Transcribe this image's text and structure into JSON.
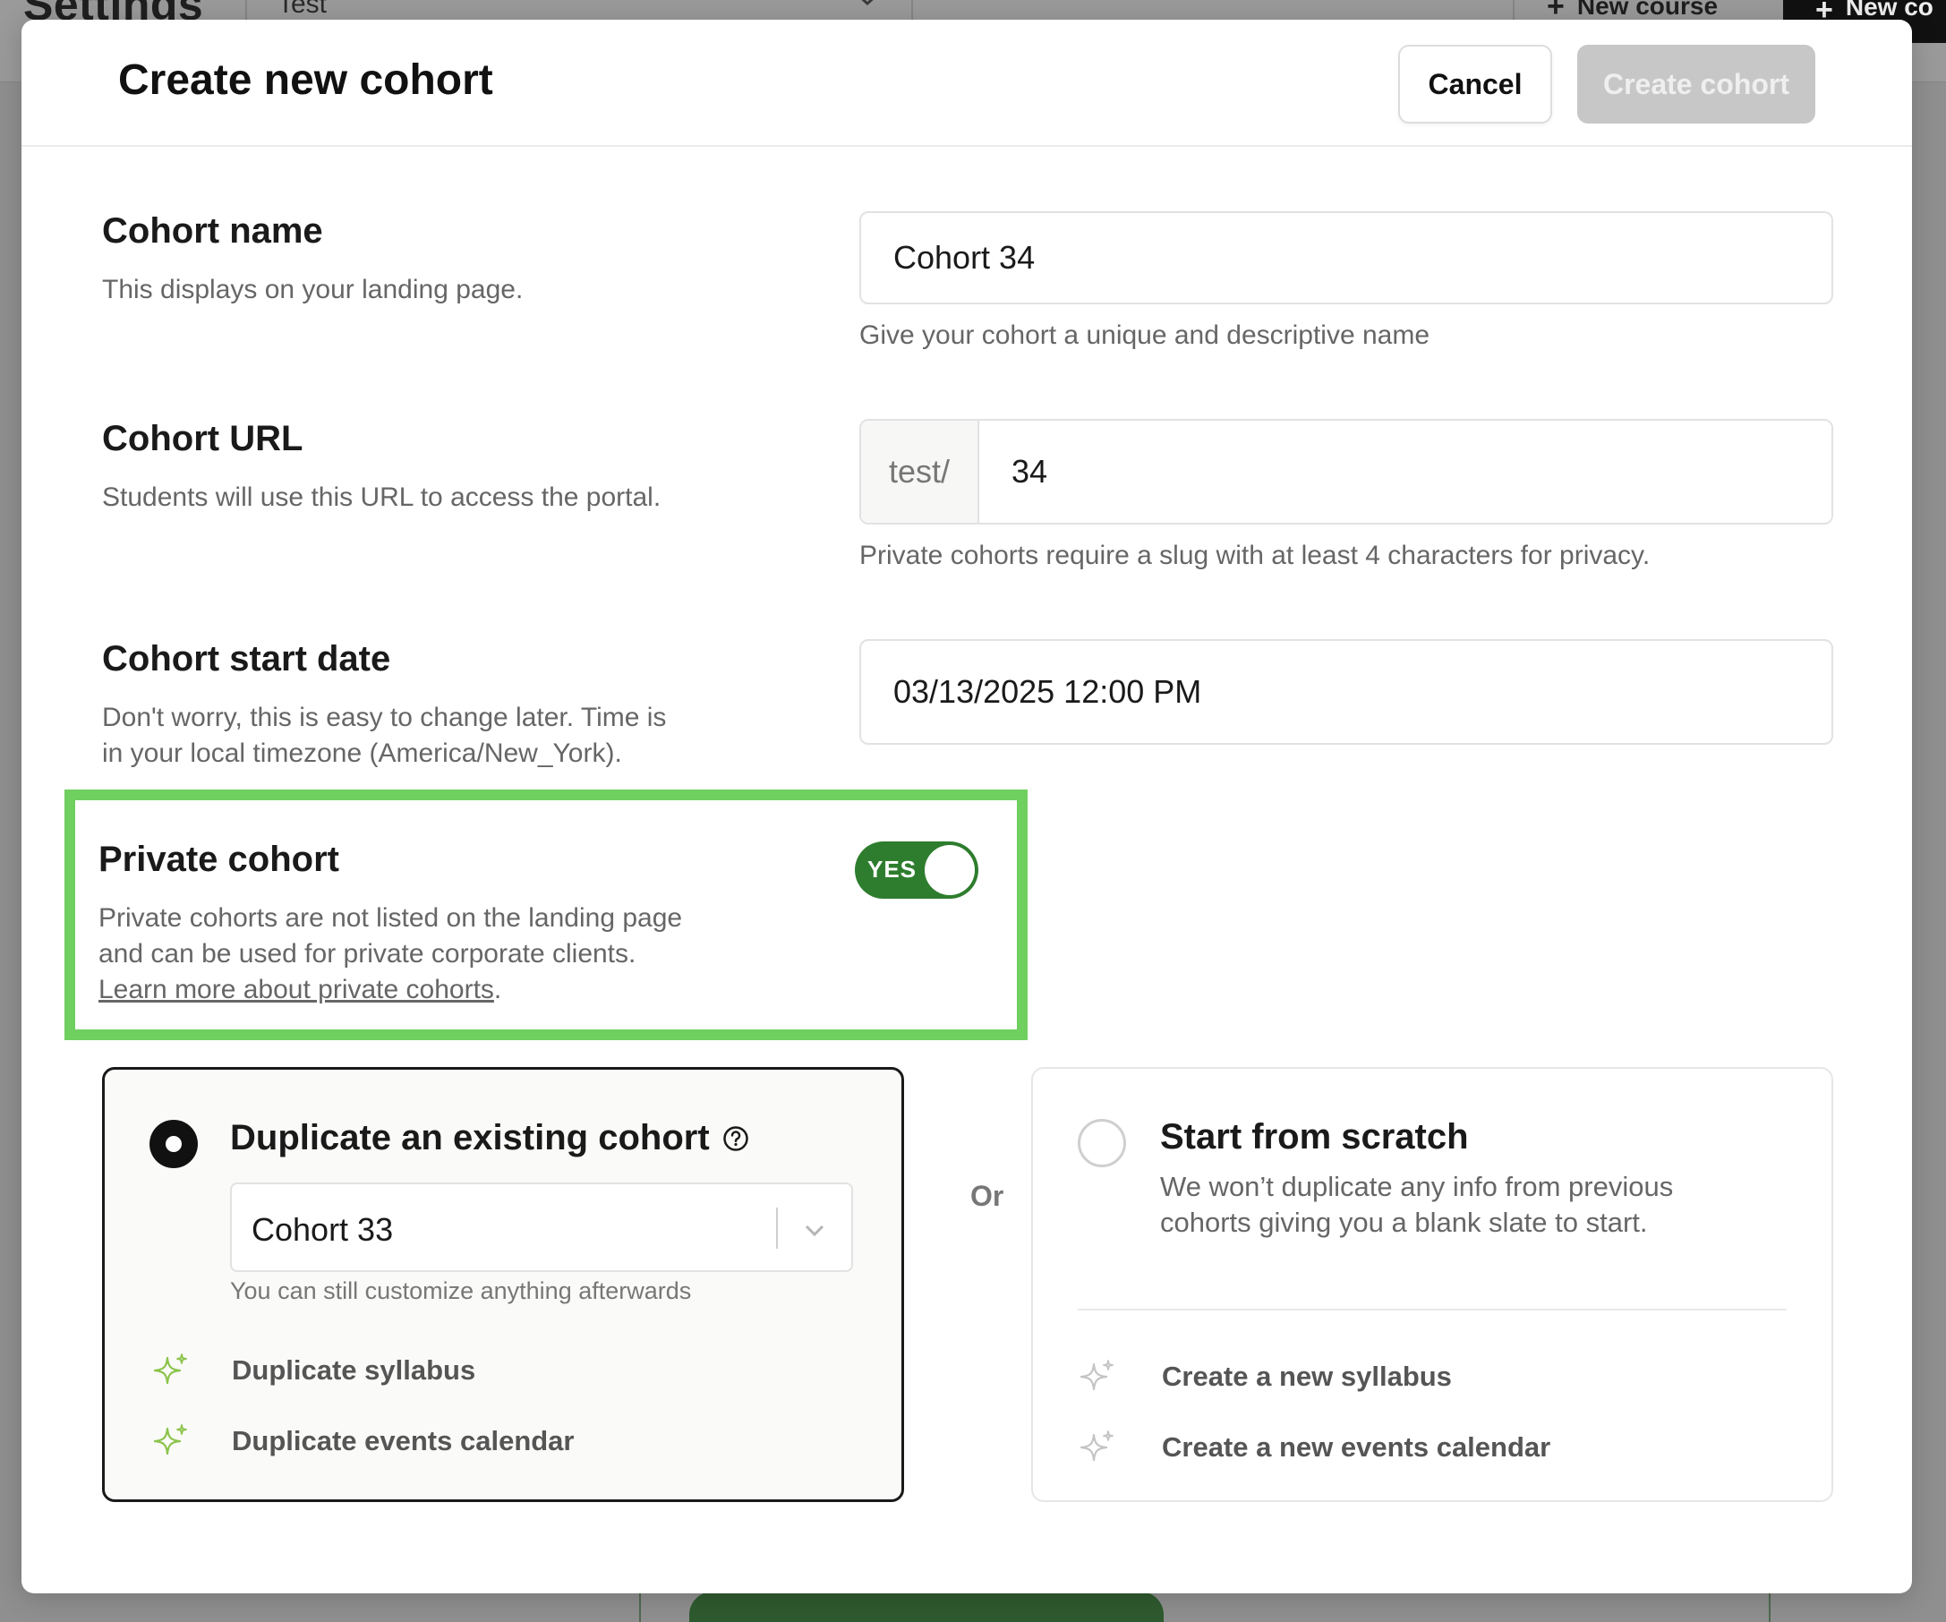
{
  "background": {
    "title": "Settings",
    "course_select": "Test",
    "new_course_label": "New course",
    "new_cohort_label": "New co"
  },
  "modal": {
    "title": "Create new cohort",
    "cancel_label": "Cancel",
    "create_label": "Create cohort"
  },
  "cohort_name": {
    "label": "Cohort name",
    "description": "This displays on your landing page.",
    "value": "Cohort 34",
    "hint": "Give your cohort a unique and descriptive name"
  },
  "cohort_url": {
    "label": "Cohort URL",
    "description": "Students will use this URL to access the portal.",
    "prefix": "test/",
    "value": "34",
    "hint": "Private cohorts require a slug with at least 4 characters for privacy."
  },
  "start_date": {
    "label": "Cohort start date",
    "description_line1": "Don't worry, this is easy to change later. Time is",
    "description_line2": "in your local timezone (America/New_York).",
    "value": "03/13/2025 12:00 PM"
  },
  "private_cohort": {
    "label": "Private cohort",
    "description_line1": "Private cohorts are not listed on the landing page",
    "description_line2": "and can be used for private corporate clients.",
    "link": "Learn more about private cohorts",
    "link_suffix": ".",
    "toggle_label": "YES",
    "enabled": true
  },
  "duplicate_option": {
    "title": "Duplicate an existing cohort",
    "selected": true,
    "select_value": "Cohort 33",
    "hint": "You can still customize anything afterwards",
    "features": [
      "Duplicate syllabus",
      "Duplicate events calendar"
    ]
  },
  "or_label": "Or",
  "scratch_option": {
    "title": "Start from scratch",
    "selected": false,
    "description_line1": "We won’t duplicate any info from previous",
    "description_line2": "cohorts giving you a blank slate to start.",
    "features": [
      "Create a new syllabus",
      "Create a new events calendar"
    ]
  },
  "colors": {
    "toggle_on": "#2e7d2e",
    "highlight_border": "#6fcf5f",
    "sparkle_active": "#8bc34a",
    "sparkle_inactive": "#c4c4c4",
    "disabled_button": "#c7c7c7"
  }
}
